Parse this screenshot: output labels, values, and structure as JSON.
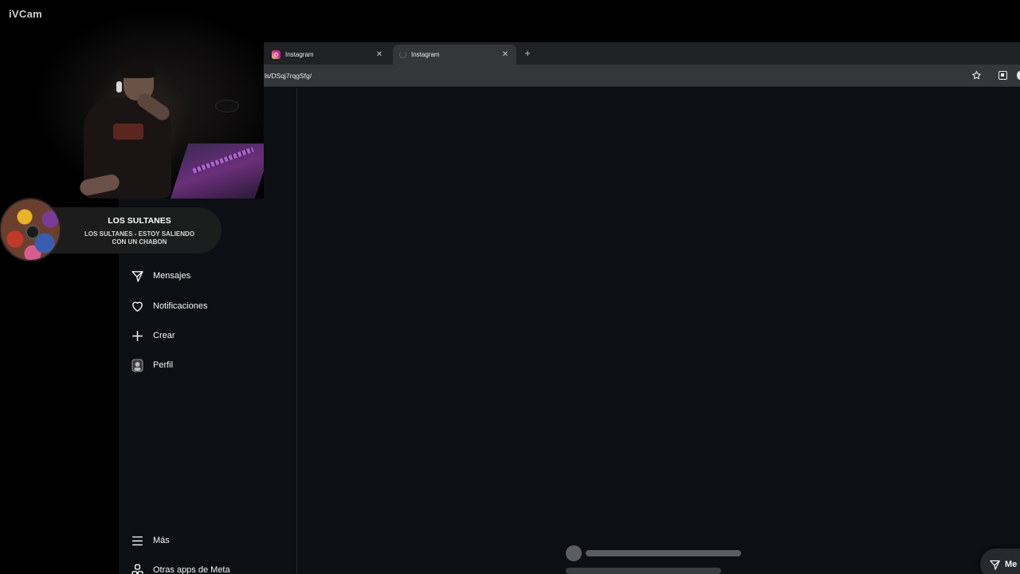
{
  "overlay": {
    "app_watermark": "iVCam",
    "now_playing": {
      "artist": "LOS SULTANES",
      "track": "LOS SULTANES - ESTOY SALIENDO CON UN CHABON"
    }
  },
  "browser": {
    "tabs": [
      {
        "title": "Instagram",
        "favicon": "instagram-icon"
      },
      {
        "title": "Instagram",
        "favicon": "loading-icon",
        "active": true
      }
    ],
    "address_bar": {
      "url": "ls/DSqj7rqgSfg/"
    }
  },
  "instagram": {
    "sidebar": {
      "items": [
        {
          "label": "Mensajes",
          "icon": "paper-plane-icon"
        },
        {
          "label": "Notificaciones",
          "icon": "heart-icon"
        },
        {
          "label": "Crear",
          "icon": "plus-icon"
        },
        {
          "label": "Perfil",
          "icon": "avatar-icon"
        }
      ],
      "bottom_items": [
        {
          "label": "Más",
          "icon": "hamburger-icon"
        },
        {
          "label": "Otras apps de Meta",
          "icon": "meta-apps-icon"
        }
      ]
    },
    "messages_pill": {
      "label": "Me"
    }
  },
  "colors": {
    "ig_background": "#0c1014",
    "chrome_tabstrip": "#202124",
    "chrome_toolbar": "#35363a",
    "skeleton": "#5a5d61"
  }
}
